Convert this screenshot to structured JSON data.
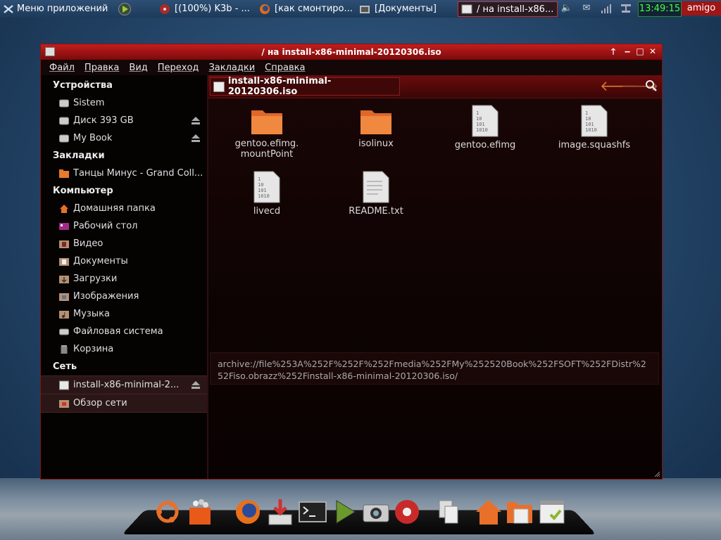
{
  "top_panel": {
    "menu_label": "Меню приложений",
    "tasks": [
      {
        "label": "[(100%) K3b - ...",
        "icon": "k3b-icon"
      },
      {
        "label": "[как смонтиро...",
        "icon": "firefox-icon"
      },
      {
        "label": "[Документы]",
        "icon": "folder-icon"
      },
      {
        "label": "/ на install-x86...",
        "icon": "disc-icon"
      }
    ],
    "clock": "13:49:15",
    "user": "amigo"
  },
  "window": {
    "title": "/ на install-x86-minimal-20120306.iso",
    "menu": [
      "Файл",
      "Правка",
      "Вид",
      "Переход",
      "Закладки",
      "Справка"
    ]
  },
  "sidebar": {
    "devices_heading": "Устройства",
    "devices": [
      {
        "label": "Sistem",
        "icon": "drive-icon",
        "eject": false
      },
      {
        "label": "Диск 393 GB",
        "icon": "drive-icon",
        "eject": true
      },
      {
        "label": "My Book",
        "icon": "drive-icon",
        "eject": true
      }
    ],
    "bookmarks_heading": "Закладки",
    "bookmarks": [
      {
        "label": "Танцы Минус - Grand Coll...",
        "icon": "folder-icon"
      }
    ],
    "computer_heading": "Компьютер",
    "computer": [
      {
        "label": "Домашняя папка",
        "icon": "home-icon"
      },
      {
        "label": "Рабочий стол",
        "icon": "desktop-icon"
      },
      {
        "label": "Видео",
        "icon": "video-folder-icon"
      },
      {
        "label": "Документы",
        "icon": "documents-folder-icon"
      },
      {
        "label": "Загрузки",
        "icon": "downloads-folder-icon"
      },
      {
        "label": "Изображения",
        "icon": "pictures-folder-icon"
      },
      {
        "label": "Музыка",
        "icon": "music-folder-icon"
      },
      {
        "label": "Файловая система",
        "icon": "filesystem-icon"
      },
      {
        "label": "Корзина",
        "icon": "trash-icon"
      }
    ],
    "network_heading": "Сеть",
    "network": [
      {
        "label": "install-x86-minimal-2...",
        "icon": "disc-icon",
        "eject": true,
        "selected": true
      },
      {
        "label": "Обзор сети",
        "icon": "network-icon",
        "eject": false,
        "selected": false
      }
    ]
  },
  "main": {
    "breadcrumb": "install-x86-minimal-20120306.iso",
    "files": [
      {
        "name": "gentoo.efimg.\nmountPoint",
        "type": "folder"
      },
      {
        "name": "isolinux",
        "type": "folder"
      },
      {
        "name": "gentoo.efimg",
        "type": "binary"
      },
      {
        "name": "image.squashfs",
        "type": "binary"
      },
      {
        "name": "livecd",
        "type": "binary"
      },
      {
        "name": "README.txt",
        "type": "text"
      }
    ],
    "address": "archive://file%253A%252F%252F%252Fmedia%252FMy%252520Book%252FSOFT%252FDistr%252Fiso.obrazz%252Finstall-x86-minimal-20120306.iso/"
  },
  "dock": {
    "items": [
      "ubuntu-icon",
      "shopping-bag-icon",
      "firefox-icon",
      "installer-icon",
      "terminal-icon",
      "play-icon",
      "camera-icon",
      "disc-burner-icon",
      "documents-icon",
      "home-icon",
      "folder-icon",
      "checklist-icon"
    ]
  }
}
